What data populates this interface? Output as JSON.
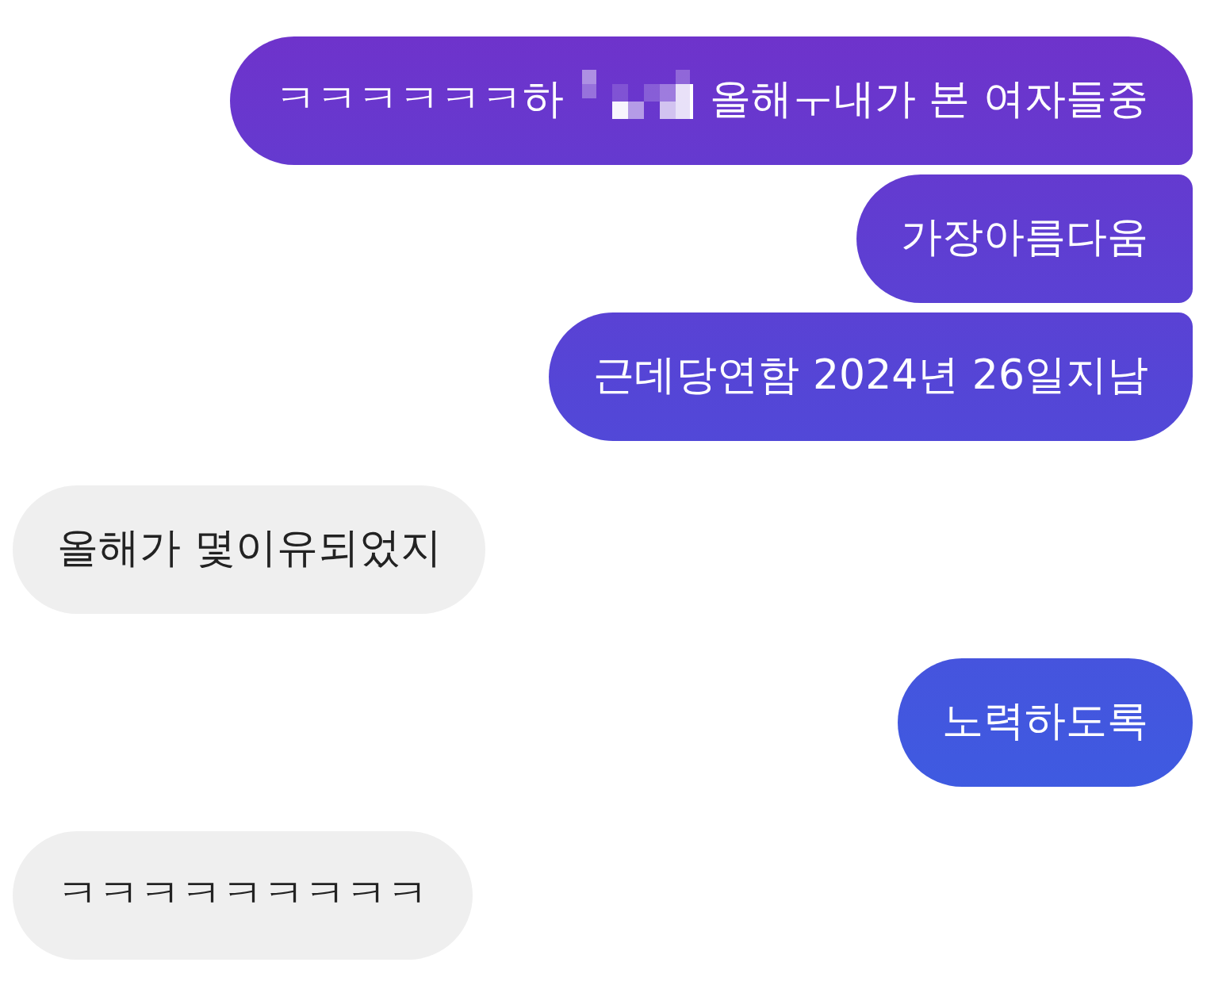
{
  "messages": [
    {
      "sent": true,
      "parts": [
        {
          "kind": "text",
          "text": "ㅋㅋㅋㅋㅋㅋ하"
        },
        {
          "kind": "redacted"
        },
        {
          "kind": "text",
          "text": "올해ㅜ내가 본 여자들중"
        }
      ]
    },
    {
      "sent": true,
      "parts": [
        {
          "kind": "text",
          "text": "가장아름다움"
        }
      ]
    },
    {
      "sent": true,
      "parts": [
        {
          "kind": "text",
          "text": "근데당연함 2024년 26일지남"
        }
      ]
    },
    {
      "sent": false,
      "parts": [
        {
          "kind": "text",
          "text": "올해가 몇이유되었지"
        }
      ]
    },
    {
      "sent": true,
      "parts": [
        {
          "kind": "text",
          "text": "노력하도록"
        }
      ]
    },
    {
      "sent": false,
      "parts": [
        {
          "kind": "text",
          "text": "ㅋㅋㅋㅋㅋㅋㅋㅋㅋ"
        }
      ]
    }
  ]
}
